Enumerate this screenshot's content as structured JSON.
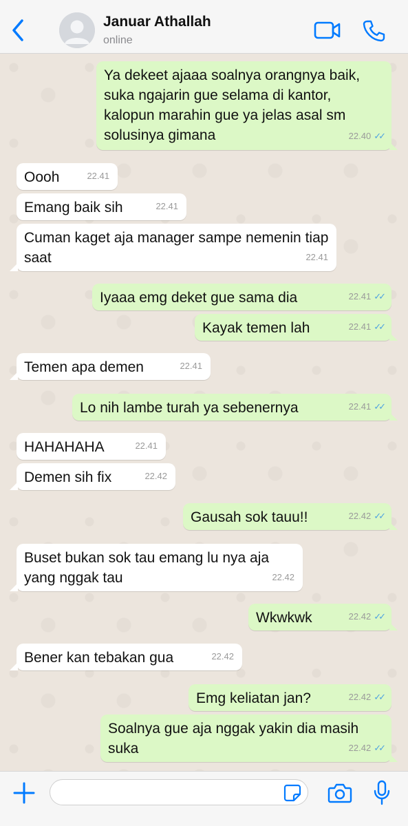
{
  "header": {
    "contact_name": "Januar Athallah",
    "status": "online"
  },
  "colors": {
    "accent": "#007aff",
    "outgoing_bubble": "#dcf8c6",
    "incoming_bubble": "#ffffff",
    "read_ticks": "#4fa3e0",
    "chat_background": "#ece5dd"
  },
  "messages": [
    {
      "dir": "out",
      "text": "Ya dekeet ajaaa soalnya orangnya baik, suka ngajarin gue selama di kantor, kalopun marahin gue ya jelas asal sm solusinya gimana",
      "time": "22.40",
      "read": true
    },
    {
      "dir": "in",
      "text": "Oooh",
      "time": "22.41"
    },
    {
      "dir": "in",
      "text": "Emang baik sih",
      "time": "22.41"
    },
    {
      "dir": "in",
      "text": "Cuman kaget aja manager sampe nemenin tiap saat",
      "time": "22.41"
    },
    {
      "dir": "out",
      "text": "Iyaaa emg deket gue sama dia",
      "time": "22.41",
      "read": true
    },
    {
      "dir": "out",
      "text": "Kayak temen lah",
      "time": "22.41",
      "read": true
    },
    {
      "dir": "in",
      "text": "Temen apa demen",
      "time": "22.41"
    },
    {
      "dir": "out",
      "text": "Lo nih lambe turah ya sebenernya",
      "time": "22.41",
      "read": true
    },
    {
      "dir": "in",
      "text": "HAHAHAHA",
      "time": "22.41"
    },
    {
      "dir": "in",
      "text": "Demen sih fix",
      "time": "22.42"
    },
    {
      "dir": "out",
      "text": "Gausah sok tauu!!",
      "time": "22.42",
      "read": true
    },
    {
      "dir": "in",
      "text": "Buset bukan sok tau emang lu nya aja yang nggak tau",
      "time": "22.42"
    },
    {
      "dir": "out",
      "text": "Wkwkwk",
      "time": "22.42",
      "read": true
    },
    {
      "dir": "in",
      "text": "Bener kan tebakan gua",
      "time": "22.42"
    },
    {
      "dir": "out",
      "text": "Emg keliatan jan?",
      "time": "22.42",
      "read": true
    },
    {
      "dir": "out",
      "text": "Soalnya gue aja nggak yakin dia masih suka",
      "time": "22.42",
      "read": true
    }
  ],
  "input": {
    "value": "",
    "placeholder": ""
  },
  "icons": {
    "back": "chevron-left-icon",
    "video": "video-camera-icon",
    "call": "phone-icon",
    "plus": "plus-icon",
    "sticker": "sticker-icon",
    "camera": "camera-icon",
    "mic": "microphone-icon",
    "read_receipt": "double-check-icon"
  }
}
